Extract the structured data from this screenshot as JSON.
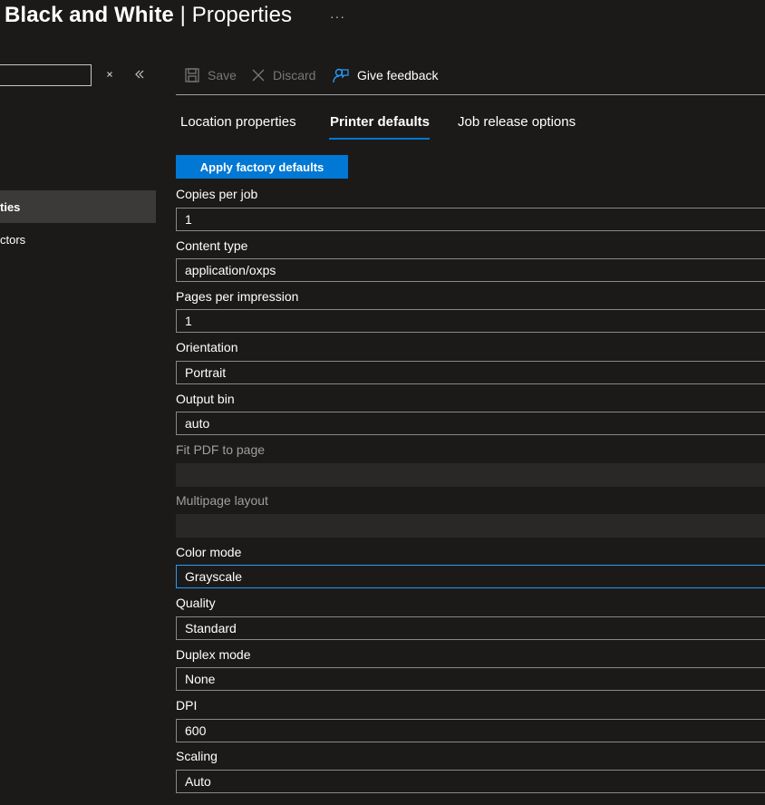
{
  "header": {
    "title_strong": "Black and White",
    "title_sep": " | ",
    "title_thin": "Properties",
    "more_label": "···"
  },
  "sidebar": {
    "search_value": "",
    "items": [
      {
        "label": "ties"
      },
      {
        "label": "ctors"
      }
    ]
  },
  "toolbar": {
    "save_label": "Save",
    "discard_label": "Discard",
    "feedback_label": "Give feedback"
  },
  "tabs": [
    {
      "label": "Location properties"
    },
    {
      "label": "Printer defaults"
    },
    {
      "label": "Job release options"
    }
  ],
  "apply_button": "Apply factory defaults",
  "fields": [
    {
      "label": "Copies per job",
      "value": "1"
    },
    {
      "label": "Content type",
      "value": "application/oxps"
    },
    {
      "label": "Pages per impression",
      "value": "1"
    },
    {
      "label": "Orientation",
      "value": "Portrait"
    },
    {
      "label": "Output bin",
      "value": "auto"
    },
    {
      "label": "Fit PDF to page",
      "value": ""
    },
    {
      "label": "Multipage layout",
      "value": ""
    },
    {
      "label": "Color mode",
      "value": "Grayscale"
    },
    {
      "label": "Quality",
      "value": "Standard"
    },
    {
      "label": "Duplex mode",
      "value": "None"
    },
    {
      "label": "DPI",
      "value": "600"
    },
    {
      "label": "Scaling",
      "value": "Auto"
    }
  ],
  "colors": {
    "accent": "#0078d4",
    "focus": "#2899f5",
    "background": "#1b1a19"
  }
}
